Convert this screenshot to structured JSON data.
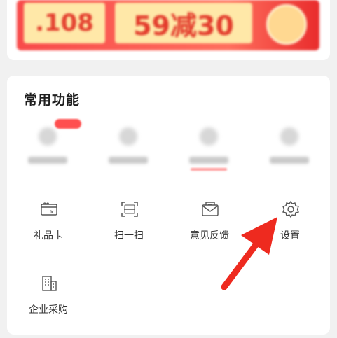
{
  "promo": {
    "coupon1": ".108",
    "coupon2": "59减30"
  },
  "section": {
    "title": "常用功能"
  },
  "functions": [
    {
      "label": "礼品卡",
      "icon": "gift-card-icon"
    },
    {
      "label": "扫一扫",
      "icon": "scan-icon"
    },
    {
      "label": "意见反馈",
      "icon": "feedback-icon"
    },
    {
      "label": "设置",
      "icon": "gear-icon"
    },
    {
      "label": "企业采购",
      "icon": "building-icon"
    }
  ],
  "colors": {
    "accent": "#e8332a",
    "icon_stroke": "#555555",
    "arrow": "#ee2a1f"
  }
}
